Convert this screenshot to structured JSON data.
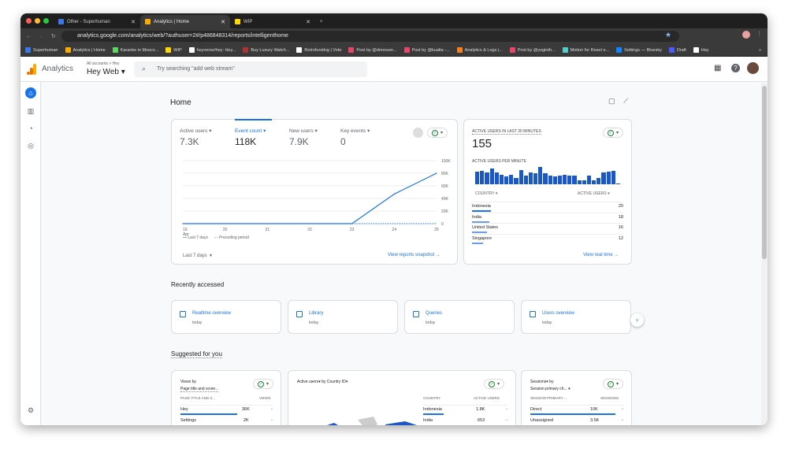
{
  "browser": {
    "tabs": [
      {
        "label": "Other - Superhuman",
        "icon": "superhuman-icon"
      },
      {
        "label": "Analytics | Home",
        "icon": "analytics-icon",
        "active": true
      },
      {
        "label": "WIP",
        "icon": "wip-icon"
      }
    ],
    "new_tab": "+",
    "url": "analytics.google.com/analytics/web/?authuser=2#/p486848314/reports/intelligenthome",
    "bookmarks": [
      "Superhuman",
      "Analytics | Home",
      "Karaoke in Mosco...",
      "WIP",
      "heyverse/hey: Hey...",
      "Buy Luxury Watch...",
      "Retrofunding | Vote",
      "Post by @donoson...",
      "Post by @kualta -...",
      "Analytics & Logs |...",
      "Post by @yoginth...",
      "Motion for React e...",
      "Settings — Bluesky",
      "Draft",
      "Hey"
    ],
    "more": "»"
  },
  "header": {
    "product": "Analytics",
    "breadcrumb": "All accounts > Hey",
    "property": "Hey Web",
    "search_placeholder": "Try searching \"add web stream\""
  },
  "page_title": "Home",
  "overview": {
    "metrics": [
      {
        "label": "Active users",
        "value": "7.3K"
      },
      {
        "label": "Event count",
        "value": "118K",
        "selected": true
      },
      {
        "label": "New users",
        "value": "7.9K"
      },
      {
        "label": "Key events",
        "value": "0"
      }
    ],
    "chart_data": {
      "type": "line",
      "x": [
        "19 Apr",
        "20",
        "21",
        "22",
        "23",
        "24",
        "25"
      ],
      "x_ticks": [
        "19",
        "20",
        "21",
        "22",
        "23",
        "24",
        "25"
      ],
      "x_sub": "Apr",
      "series": [
        {
          "name": "Last 7 days",
          "values": [
            0,
            0,
            0,
            0,
            0,
            47000,
            80000
          ],
          "color": "#1a73e8"
        },
        {
          "name": "Preceding period",
          "values": [
            null,
            null,
            null,
            null,
            0,
            0,
            0
          ],
          "dashed": true
        }
      ],
      "y_ticks": [
        "100K",
        "80K",
        "60K",
        "40K",
        "20K",
        "0"
      ],
      "ylim": [
        0,
        100000
      ],
      "grid": true,
      "legend": "bottom-left"
    },
    "range": "Last 7 days",
    "link": "View reports snapshot"
  },
  "realtime": {
    "title": "ACTIVE USERS IN LAST 30 MINUTES",
    "value": "155",
    "sub": "ACTIVE USERS PER MINUTE",
    "per_minute": [
      40,
      42,
      37,
      49,
      37,
      31,
      26,
      30,
      20,
      45,
      27,
      37,
      34,
      55,
      35,
      28,
      25,
      27,
      30,
      27,
      27,
      12,
      12,
      27,
      12,
      20,
      37,
      40,
      43,
      3
    ],
    "col1": "COUNTRY",
    "col2": "ACTIVE USERS",
    "rows": [
      {
        "country": "Indonesia",
        "users": "20",
        "share": 1
      },
      {
        "country": "India",
        "users": "18",
        "share": 0.9
      },
      {
        "country": "United States",
        "users": "16",
        "share": 0.8
      },
      {
        "country": "Singapore",
        "users": "12",
        "share": 0.6
      }
    ],
    "link": "View real time"
  },
  "recent": {
    "title": "Recently accessed",
    "items": [
      {
        "label": "Realtime overview",
        "time": "today"
      },
      {
        "label": "Library",
        "time": "today"
      },
      {
        "label": "Queries",
        "time": "today"
      },
      {
        "label": "Users overview",
        "time": "today"
      }
    ]
  },
  "suggested": {
    "title": "Suggested for you",
    "views": {
      "title1": "Views by",
      "title2": "Page title and scree...",
      "col1": "PAGE TITLE AND S...",
      "col2": "VIEWS",
      "rows": [
        {
          "k": "Hey",
          "v": "36K"
        },
        {
          "k": "Settings",
          "v": "2K"
        }
      ]
    },
    "country": {
      "title": "Active users▾ by Country ID▾",
      "col1": "COUNTRY",
      "col2": "ACTIVE USERS",
      "rows": [
        {
          "k": "Indonesia",
          "v": "1.8K"
        },
        {
          "k": "India",
          "v": "653"
        }
      ]
    },
    "sessions": {
      "title1": "Sessions▾ by",
      "title2": "Session primary ch... ▾",
      "col1": "SESSION PRIMARY ...",
      "col2": "SESSIONS",
      "rows": [
        {
          "k": "Direct",
          "v": "10K"
        },
        {
          "k": "Unassigned",
          "v": "3.5K"
        }
      ]
    },
    "dash": "-"
  },
  "colors": {
    "accent": "#1a73e8",
    "ga_orange": "#f9ab00"
  }
}
